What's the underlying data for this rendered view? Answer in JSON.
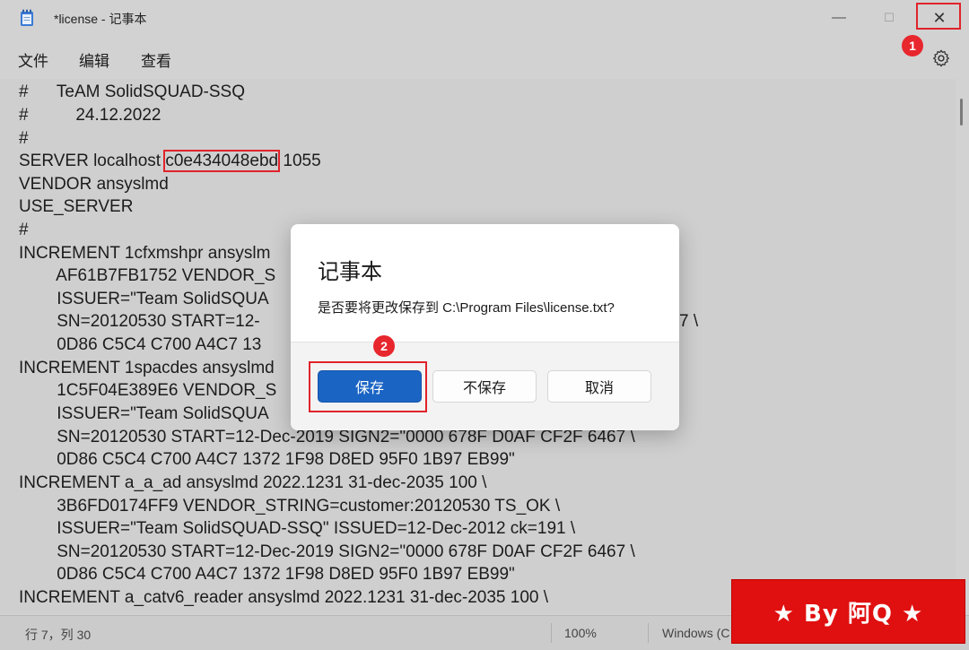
{
  "window": {
    "title": "*license - 记事本",
    "min_glyph": "—",
    "max_glyph": "☐",
    "close_glyph": "✕"
  },
  "menu": {
    "file": "文件",
    "edit": "编辑",
    "view": "查看"
  },
  "editor": {
    "lines": [
      "#      TeAM SolidSQUAD-SSQ",
      "#          24.12.2022",
      "#",
      "SERVER localhost ",
      "VENDOR ansyslmd",
      "USE_SERVER",
      "#",
      "INCREMENT 1cfxmshpr ansyslm",
      "        AF61B7FB1752 VENDOR_S",
      "        ISSUER=\"Team SolidSQUA",
      "        SN=20120530 START=12-",
      "        0D86 C5C4 C700 A4C7 13",
      "INCREMENT 1spacdes ansyslmd",
      "        1C5F04E389E6 VENDOR_S",
      "        ISSUER=\"Team SolidSQUA",
      "        SN=20120530 START=12-Dec-2019 SIGN2=\"0000 678F D0AF CF2F 6467 \\",
      "        0D86 C5C4 C700 A4C7 1372 1F98 D8ED 95F0 1B97 EB99\"",
      "INCREMENT a_a_ad ansyslmd 2022.1231 31-dec-2035 100 \\",
      "        3B6FD0174FF9 VENDOR_STRING=customer:20120530 TS_OK \\",
      "        ISSUER=\"Team SolidSQUAD-SSQ\" ISSUED=12-Dec-2012 ck=191 \\",
      "        SN=20120530 START=12-Dec-2019 SIGN2=\"0000 678F D0AF CF2F 6467 \\",
      "        0D86 C5C4 C700 A4C7 1372 1F98 D8ED 95F0 1B97 EB99\"",
      "INCREMENT a_catv6_reader ansyslmd 2022.1231 31-dec-2035 100 \\"
    ],
    "server_host_id": "c0e434048ebd",
    "server_port": " 1055",
    "right_tail_line10": "7 \\"
  },
  "status": {
    "position": "行 7，列 30",
    "zoom": "100%",
    "line_ending": "Windows (C"
  },
  "dialog": {
    "title": "记事本",
    "message": "是否要将更改保存到 C:\\Program Files\\license.txt?",
    "save": "保存",
    "dont_save": "不保存",
    "cancel": "取消"
  },
  "annotations": {
    "badge1": "1",
    "badge2": "2"
  },
  "watermark": "★ By 阿Q ★",
  "colors": {
    "accent": "#1a64c4",
    "annotation_red": "#e0232b"
  }
}
